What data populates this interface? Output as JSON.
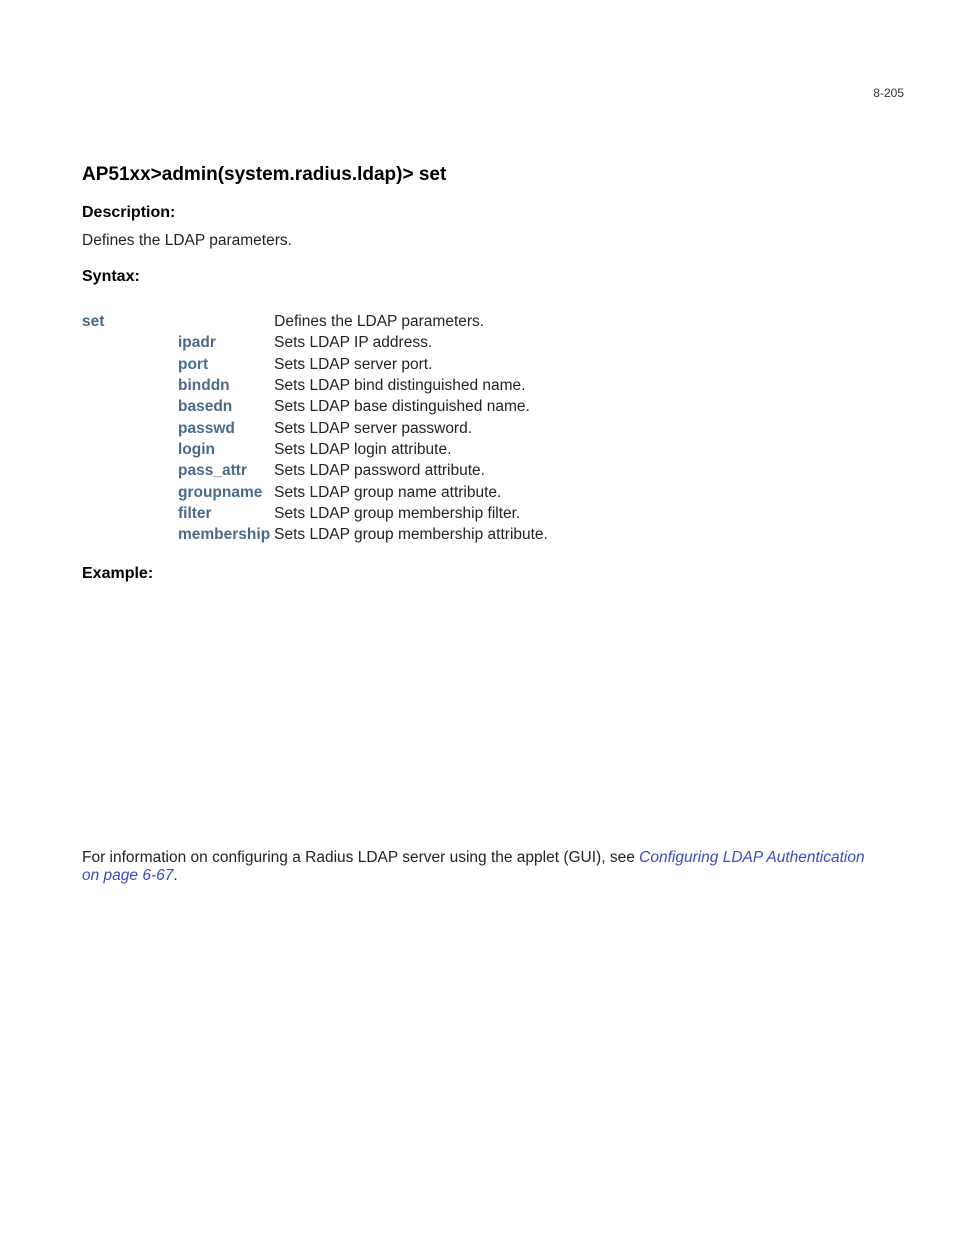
{
  "pageNumber": "8-205",
  "title": "AP51xx>admin(system.radius.ldap)> set",
  "labels": {
    "description": "Description:",
    "syntax": "Syntax:",
    "example": "Example:"
  },
  "descriptionText": "Defines the LDAP parameters.",
  "syntax": {
    "command": "set",
    "commandDesc": "Defines the LDAP parameters.",
    "rows": [
      {
        "arg": "ipadr",
        "desc": "Sets LDAP IP address."
      },
      {
        "arg": "port",
        "desc": "Sets LDAP server port."
      },
      {
        "arg": "binddn",
        "desc": "Sets LDAP bind distinguished name."
      },
      {
        "arg": "basedn",
        "desc": "Sets LDAP base distinguished name."
      },
      {
        "arg": "passwd",
        "desc": "Sets LDAP server password."
      },
      {
        "arg": "login",
        "desc": "Sets LDAP login attribute."
      },
      {
        "arg": "pass_attr",
        "desc": "Sets LDAP password attribute."
      },
      {
        "arg": "groupname",
        "desc": "Sets LDAP group name attribute."
      },
      {
        "arg": "filter",
        "desc": "Sets LDAP group membership filter."
      },
      {
        "arg": "membership",
        "desc": "Sets LDAP group membership attribute."
      }
    ]
  },
  "footer": {
    "prefix": "For information on configuring a Radius LDAP server using the applet (GUI), see ",
    "linkText": "Configuring LDAP Authentication on page 6-67",
    "suffix": "."
  }
}
